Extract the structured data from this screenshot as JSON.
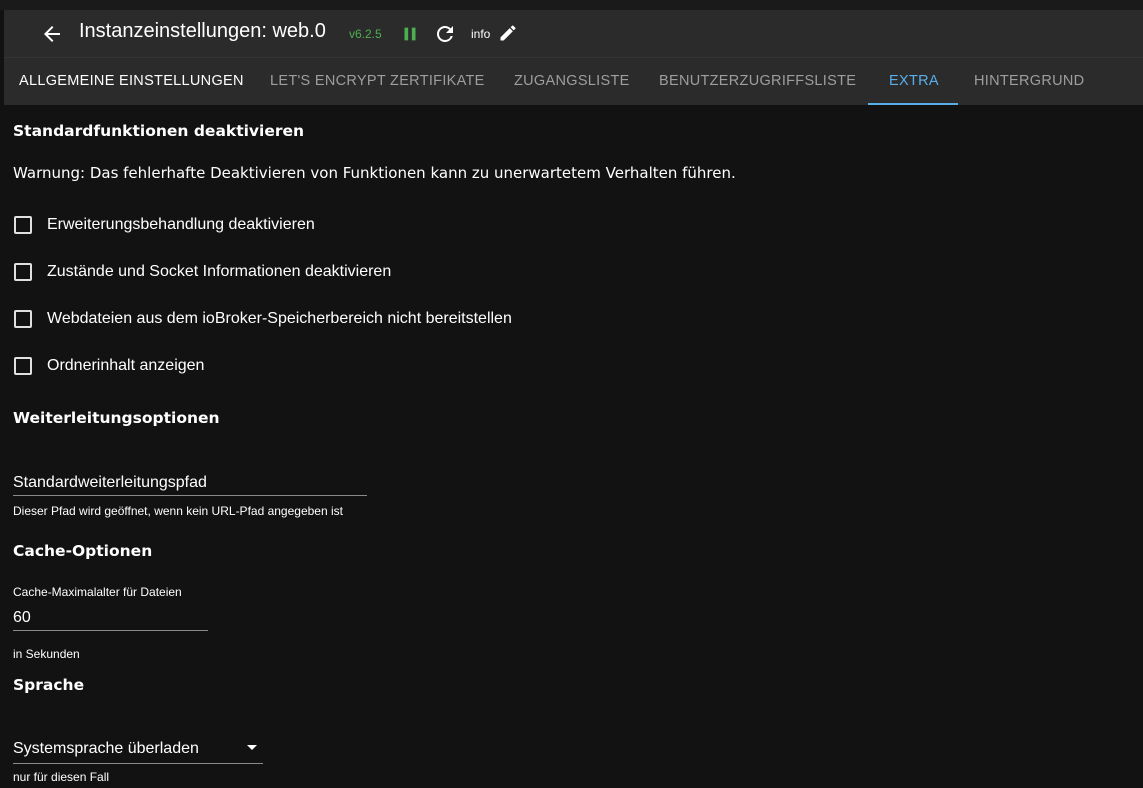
{
  "header": {
    "title": "Instanzeinstellungen: web.0",
    "version": "v6.2.5",
    "log_level": "info",
    "colors": {
      "background": "#2b2b2b",
      "version": "#4caf50",
      "pause": "#4caf50"
    }
  },
  "tabs": [
    {
      "label": "ALLGEMEINE EINSTELLUNGEN"
    },
    {
      "label": "LET'S ENCRYPT ZERTIFIKATE"
    },
    {
      "label": "ZUGANGSLISTE"
    },
    {
      "label": "BENUTZERZUGRIFFSLISTE"
    },
    {
      "label": "EXTRA",
      "selected": true
    },
    {
      "label": "HINTERGRUND"
    }
  ],
  "tab_accent": "#5aaee8",
  "sections": {
    "disable_defaults": {
      "title": "Standardfunktionen deaktivieren",
      "warning": "Warnung: Das fehlerhafte Deaktivieren von Funktionen kann zu unerwartetem Verhalten führen.",
      "checkboxes": [
        {
          "label": "Erweiterungsbehandlung deaktivieren",
          "checked": false
        },
        {
          "label": "Zustände und Socket Informationen deaktivieren",
          "checked": false
        },
        {
          "label": "Webdateien aus dem ioBroker-Speicherbereich nicht bereitstellen",
          "checked": false
        },
        {
          "label": "Ordnerinhalt anzeigen",
          "checked": false
        }
      ]
    },
    "redirect": {
      "title": "Weiterleitungsoptionen",
      "path_placeholder": "Standardweiterleitungspfad",
      "path_value": "",
      "helper": "Dieser Pfad wird geöffnet, wenn kein URL-Pfad angegeben ist"
    },
    "cache": {
      "title": "Cache-Optionen",
      "max_age_label": "Cache-Maximalalter für Dateien",
      "max_age_value": "60",
      "helper": "in Sekunden"
    },
    "language": {
      "title": "Sprache",
      "select_value": "Systemsprache überladen",
      "helper": "nur für diesen Fall"
    }
  },
  "icons": [
    "arrow-back-icon",
    "pause-icon",
    "refresh-icon",
    "edit-pencil-icon",
    "chevron-down-icon"
  ]
}
